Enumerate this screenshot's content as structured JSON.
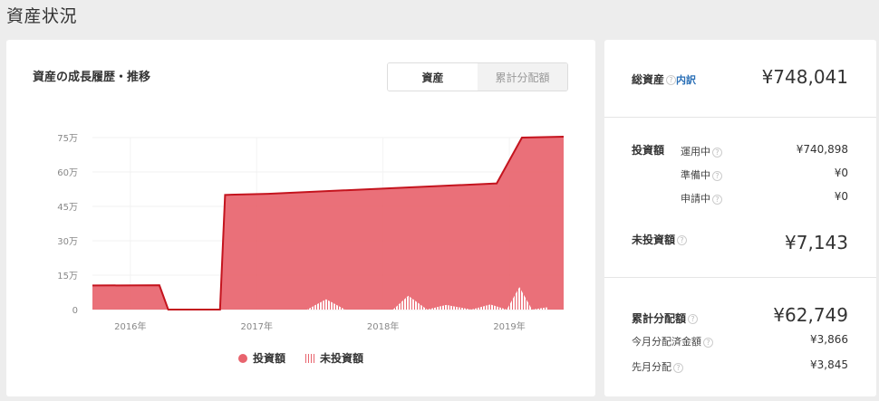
{
  "page": {
    "title": "資産状況"
  },
  "chart_card": {
    "title": "資産の成長履歴・推移",
    "toggle": {
      "active": "資産",
      "inactive": "累計分配額"
    }
  },
  "chart_data": {
    "type": "area",
    "y_ticks": [
      "75万",
      "60万",
      "45万",
      "30万",
      "15万",
      "0"
    ],
    "ylim": [
      0,
      750000
    ],
    "x_ticks": [
      {
        "label": "2016年",
        "t": 2016.0
      },
      {
        "label": "2017年",
        "t": 2017.0
      },
      {
        "label": "2018年",
        "t": 2018.0
      },
      {
        "label": "2019年",
        "t": 2019.0
      }
    ],
    "xlim": [
      2015.7,
      2019.43
    ],
    "series": [
      {
        "name": "投資額",
        "color": "#e8646e",
        "x": [
          2015.7,
          2016.23,
          2016.3,
          2016.71,
          2016.75,
          2017.09,
          2018.9,
          2019.1,
          2019.43
        ],
        "y": [
          105000,
          106000,
          0,
          0,
          500000,
          505000,
          550000,
          750000,
          754000
        ]
      },
      {
        "name": "未投資額",
        "color": "#e8646e",
        "x": [
          2017.4,
          2017.55,
          2017.7,
          2017.85,
          2018.08,
          2018.2,
          2018.35,
          2018.5,
          2018.7,
          2018.85,
          2018.98,
          2019.08,
          2019.18,
          2019.3
        ],
        "y": [
          0,
          45000,
          0,
          0,
          0,
          60000,
          0,
          20000,
          0,
          22000,
          0,
          98000,
          0,
          10000
        ]
      }
    ],
    "legend": [
      "投資額",
      "未投資額"
    ]
  },
  "summary": {
    "total": {
      "label": "総資産",
      "link": "内訳",
      "value": "¥748,041"
    },
    "invested": {
      "label": "投資額",
      "rows": [
        {
          "label": "運用中",
          "value": "¥740,898"
        },
        {
          "label": "準備中",
          "value": "¥0"
        },
        {
          "label": "申請中",
          "value": "¥0"
        }
      ]
    },
    "uninvested": {
      "label": "未投資額",
      "value": "¥7,143"
    },
    "distribution": {
      "label": "累計分配額",
      "value": "¥62,749",
      "rows": [
        {
          "label": "今月分配済金額",
          "value": "¥3,866"
        },
        {
          "label": "先月分配",
          "value": "¥3,845"
        }
      ]
    },
    "help_icon": "?"
  }
}
